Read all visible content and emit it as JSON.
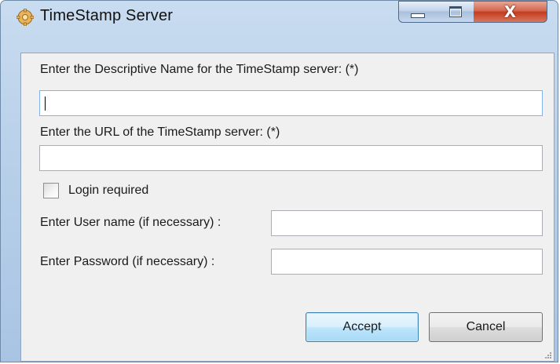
{
  "window": {
    "title": "TimeStamp Server",
    "close_glyph": "X"
  },
  "form": {
    "name_label": "Enter the Descriptive Name for the TimeStamp server: (*)",
    "name_value": "",
    "url_label": "Enter the URL of the TimeStamp server: (*)",
    "url_value": "",
    "login_required_label": "Login required",
    "login_required_checked": false,
    "username_label": "Enter User name (if necessary) :",
    "username_value": "",
    "password_label": "Enter Password (if necessary) :",
    "password_value": ""
  },
  "buttons": {
    "accept_label": "Accept",
    "cancel_label": "Cancel"
  },
  "icons": {
    "app": "puzzle-gear-icon",
    "minimize": "minimize-icon",
    "maximize": "maximize-icon",
    "close": "close-icon",
    "grip": "resize-grip-icon"
  },
  "colors": {
    "titlebar": "#b9d1ea",
    "close_button": "#c23c1f",
    "default_button_border": "#3c7fb1",
    "focus_border": "#7eb4ea"
  }
}
